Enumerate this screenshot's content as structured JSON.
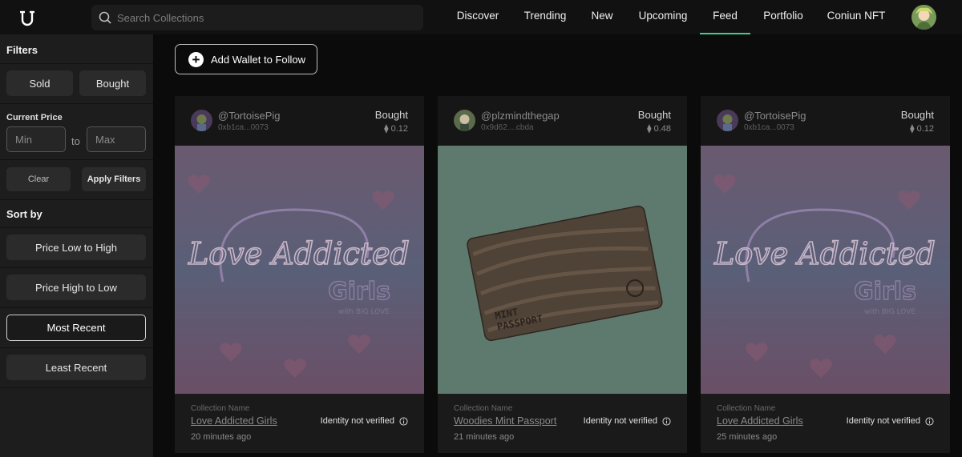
{
  "nav": {
    "search_placeholder": "Search Collections",
    "items": [
      "Discover",
      "Trending",
      "New",
      "Upcoming",
      "Feed",
      "Portfolio",
      "Coniun NFT"
    ],
    "active": "Feed",
    "accent": "#3ecf8e"
  },
  "sidebar": {
    "filters_title": "Filters",
    "sold_label": "Sold",
    "bought_label": "Bought",
    "current_price_label": "Current Price",
    "min_placeholder": "Min",
    "to_label": "to",
    "max_placeholder": "Max",
    "clear_label": "Clear",
    "apply_label": "Apply Filters",
    "sort_title": "Sort by",
    "sort_options": [
      "Price Low to High",
      "Price High to Low",
      "Most Recent",
      "Least Recent"
    ],
    "sort_selected": "Most Recent"
  },
  "main": {
    "add_wallet_label": "Add Wallet to Follow"
  },
  "cards": [
    {
      "user": "@TortoisePig",
      "address": "0xb1ca...0073",
      "action": "Bought",
      "price": "0.12",
      "collection_label": "Collection Name",
      "collection": "Love Addicted Girls",
      "time": "20 minutes ago",
      "verify": "Identity not verified",
      "art": "love-addicted",
      "art_title": "Love Addicted",
      "art_subtitle": "Girls",
      "art_tagline": "with BIG LOVE"
    },
    {
      "user": "@plzmindthegap",
      "address": "0x9d62....cbda",
      "action": "Bought",
      "price": "0.48",
      "collection_label": "Collection Name",
      "collection": "Woodies Mint Passport",
      "time": "21 minutes ago",
      "verify": "Identity not verified",
      "art": "mint-passport",
      "art_title": "MINT",
      "art_subtitle": "PASSPORT",
      "art_tagline": ""
    },
    {
      "user": "@TortoisePig",
      "address": "0xb1ca...0073",
      "action": "Bought",
      "price": "0.12",
      "collection_label": "Collection Name",
      "collection": "Love Addicted Girls",
      "time": "25 minutes ago",
      "verify": "Identity not verified",
      "art": "love-addicted",
      "art_title": "Love Addicted",
      "art_subtitle": "Girls",
      "art_tagline": "with BIG LOVE"
    }
  ]
}
